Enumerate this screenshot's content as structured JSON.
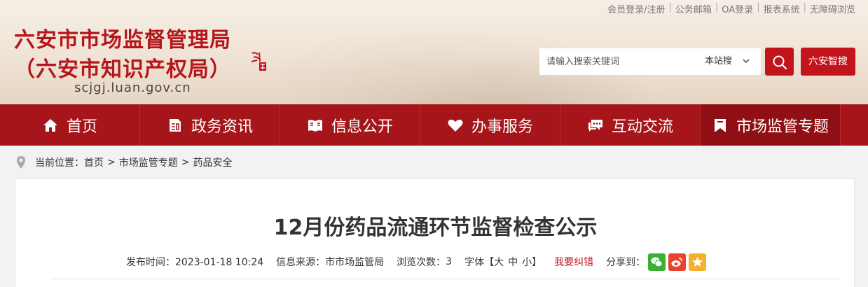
{
  "top_links": [
    "会员登录/注册",
    "公务邮箱",
    "OA登录",
    "报表系统",
    "无障碍浏览"
  ],
  "site": {
    "title_line1": "六安市市场监督管理局",
    "title_line2": "（六安市知识产权局）",
    "domain": "scjgj.luan.gov.cn"
  },
  "search": {
    "placeholder": "请输入搜索关键词",
    "scope": "本站搜",
    "smart_label": "六安智搜"
  },
  "nav": [
    {
      "label": "首页",
      "icon": "home-icon"
    },
    {
      "label": "政务资讯",
      "icon": "news-icon"
    },
    {
      "label": "信息公开",
      "icon": "info-icon"
    },
    {
      "label": "办事服务",
      "icon": "heart-icon"
    },
    {
      "label": "互动交流",
      "icon": "chat-icon"
    },
    {
      "label": "市场监管专题",
      "icon": "bookmark-icon",
      "active": true
    }
  ],
  "breadcrumb": {
    "prefix": "当前位置：",
    "items": [
      "首页",
      "市场监管专题",
      "药品安全"
    ]
  },
  "article": {
    "title": "12月份药品流通环节监督检查公示",
    "publish_time": "发布时间：2023-01-18 10:24",
    "source": "信息来源：市市场监管局",
    "views_label": "浏览次数：",
    "views": "3",
    "font_label": "字体【",
    "font_large": "大",
    "font_medium": "中",
    "font_small": "小",
    "font_close": "】",
    "report_error": "我要纠错",
    "share_label": "分享到："
  },
  "colors": {
    "brand_red": "#a5151a",
    "button_red": "#c1151b",
    "wechat_green": "#3cb034",
    "weibo_red": "#e8432f",
    "qzone_yellow": "#f4b12f"
  }
}
